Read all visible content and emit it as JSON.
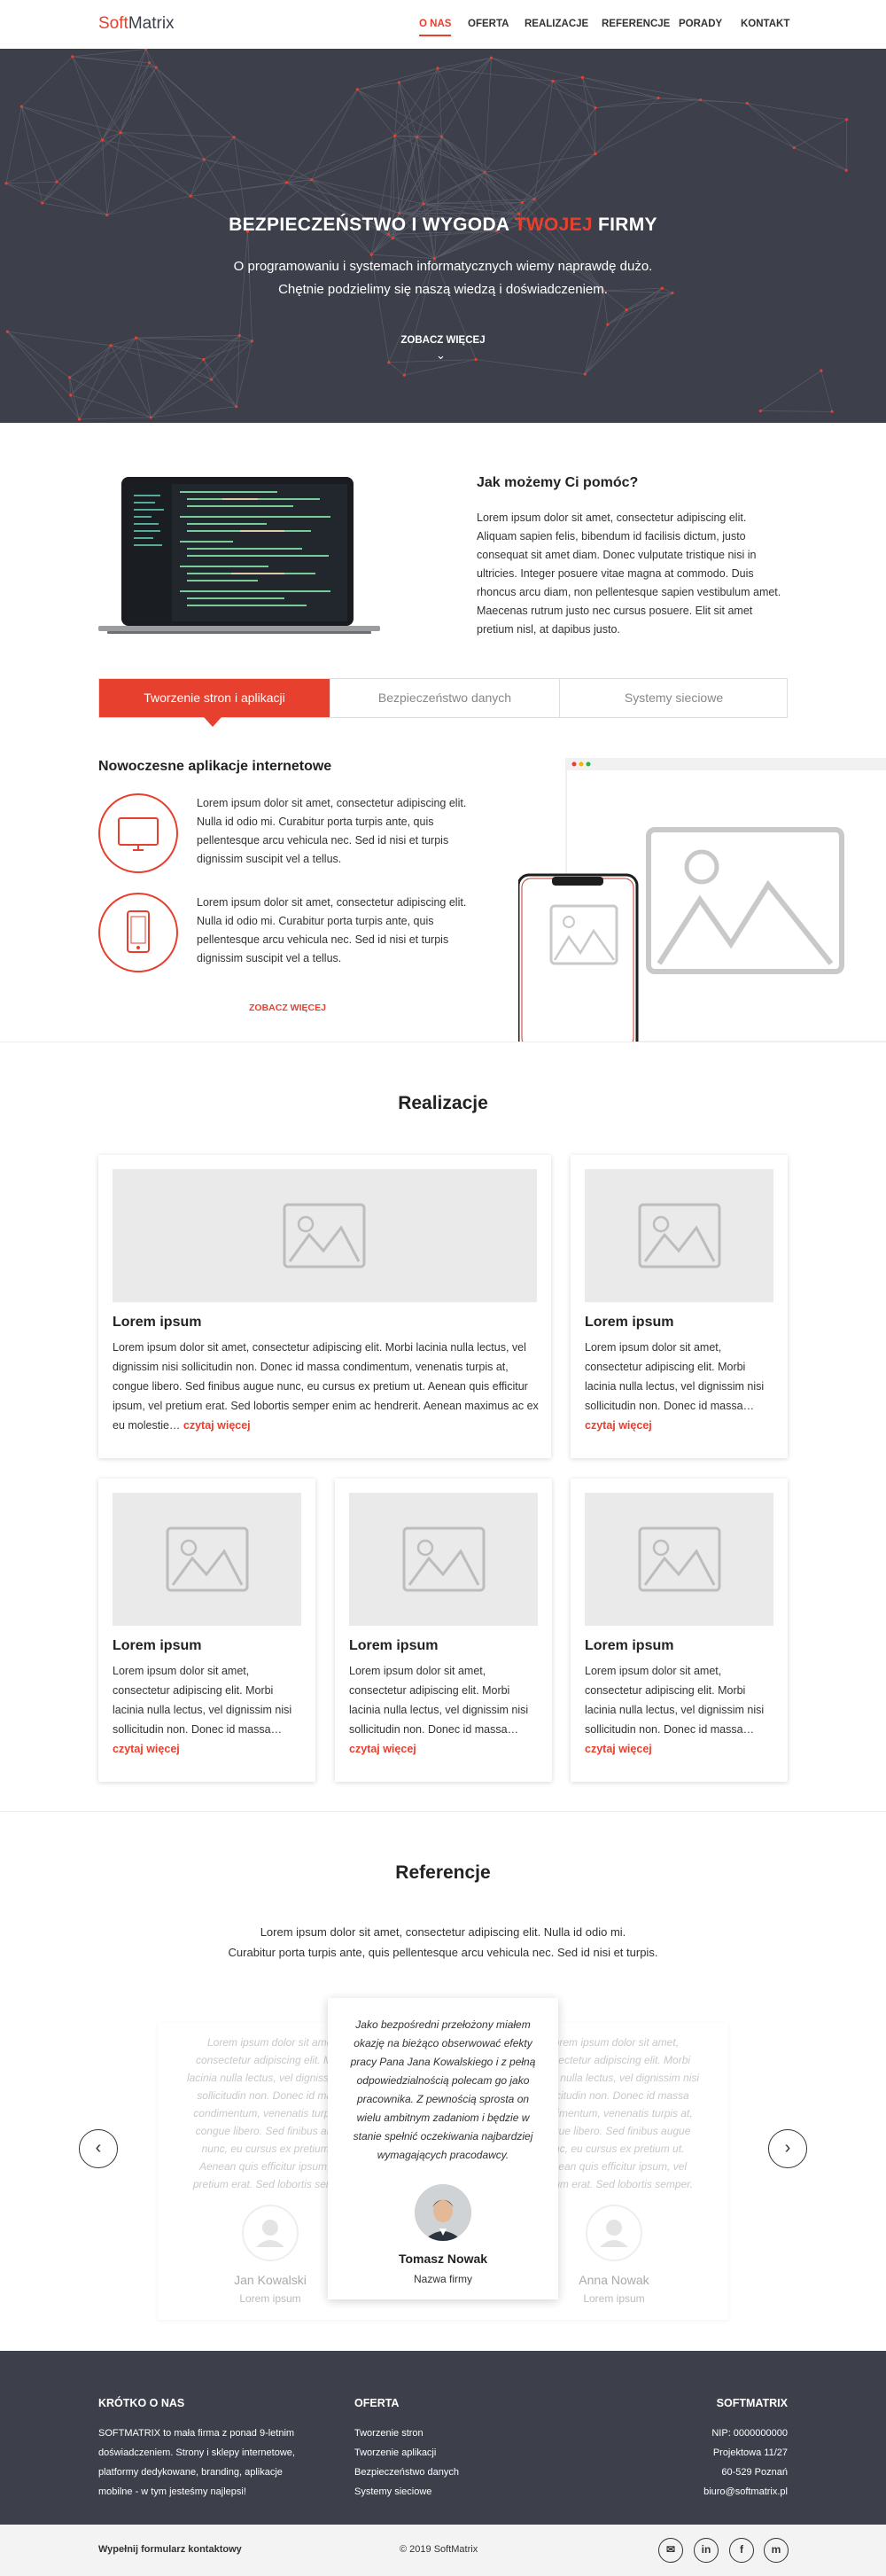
{
  "brand": {
    "soft": "Soft",
    "matrix": "Matrix"
  },
  "nav": [
    "O NAS",
    "OFERTA",
    "REALIZACJE",
    "REFERENCJE",
    "PORADY",
    "KONTAKT"
  ],
  "hero": {
    "title_a": "BEZPIECZEŃSTWO I WYGODA ",
    "title_b": "TWOJEJ",
    "title_c": " FIRMY",
    "sub1": "O programowaniu i systemach informatycznych wiemy naprawdę dużo.",
    "sub2": "Chętnie podzielimy się naszą wiedzą i doświadczeniem.",
    "more": "ZOBACZ WIĘCEJ"
  },
  "help": {
    "title": "Jak możemy Ci pomóc?",
    "text": "Lorem ipsum dolor sit amet, consectetur adipiscing elit. Aliquam sapien felis, bibendum id facilisis dictum, justo consequat sit amet diam. Donec vulputate tristique nisi in ultricies. Integer posuere vitae magna at commodo. Duis rhoncus arcu diam, non pellentesque sapien vestibulum amet. Maecenas rutrum justo nec cursus posuere. Elit sit amet pretium nisl, at dapibus justo."
  },
  "tabs": [
    "Tworzenie stron i aplikacji",
    "Bezpieczeństwo danych",
    "Systemy sieciowe"
  ],
  "apps": {
    "title": "Nowoczesne aplikacje internetowe",
    "item1": "Lorem ipsum dolor sit amet, consectetur adipiscing elit. Nulla id odio mi. Curabitur porta turpis ante, quis pellentesque arcu vehicula nec. Sed id nisi et turpis dignissim suscipit vel a tellus.",
    "item2": "Lorem ipsum dolor sit amet, consectetur adipiscing elit. Nulla id odio mi. Curabitur porta turpis ante, quis pellentesque arcu vehicula nec. Sed id nisi et turpis dignissim suscipit vel a tellus.",
    "more": "ZOBACZ WIĘCEJ"
  },
  "realizacje": {
    "title": "Realizacje",
    "big_title": "Lorem ipsum",
    "big_text": "Lorem ipsum dolor sit amet, consectetur adipiscing elit. Morbi lacinia nulla lectus, vel dignissim nisi sollicitudin non. Donec id massa condimentum, venenatis turpis at, congue libero. Sed finibus augue nunc, eu cursus ex pretium ut. Aenean quis efficitur ipsum, vel pretium erat. Sed lobortis semper enim ac hendrerit. Aenean maximus ac ex eu molestie… ",
    "small_title": "Lorem ipsum",
    "small_text": "Lorem ipsum dolor sit amet, consectetur adipiscing elit. Morbi lacinia nulla lectus, vel dignissim nisi sollicitudin non. Donec id massa… ",
    "more": "czytaj więcej"
  },
  "referencje": {
    "title": "Referencje",
    "intro1": "Lorem ipsum dolor sit amet, consectetur adipiscing elit. Nulla id odio mi.",
    "intro2": "Curabitur porta turpis ante, quis pellentesque arcu vehicula nec. Sed id nisi et turpis.",
    "faded_text": "Lorem ipsum dolor sit amet, consectetur adipiscing elit. Morbi lacinia nulla lectus, vel dignissim nisi sollicitudin non. Donec id massa condimentum, venenatis turpis at, congue libero. Sed finibus augue nunc, eu cursus ex pretium ut. Aenean quis efficitur ipsum, vel pretium erat. Sed lobortis semper.",
    "left_name": "Jan Kowalski",
    "left_role": "Lorem ipsum",
    "right_name": "Anna Nowak",
    "right_role": "Lorem ipsum",
    "quote": "Jako bezpośredni przełożony miałem okazję na bieżąco obserwować efekty pracy Pana Jana Kowalskiego i z pełną odpowiedzialnością polecam go jako pracownika. Z pewnością sprosta on wielu ambitnym zadaniom i będzie w stanie spełnić oczekiwania najbardziej wymagających pracodawcy.",
    "name": "Tomasz Nowak",
    "role": "Nazwa firmy"
  },
  "footer": {
    "about_title": "KRÓTKO O NAS",
    "about_text": "SOFTMATRIX to  mała firma z ponad 9-letnim doświadczeniem. Strony i sklepy internetowe, platformy dedykowane, branding, aplikacje mobilne - w tym jesteśmy najlepsi!",
    "offer_title": "OFERTA",
    "offer": [
      "Tworzenie stron",
      "Tworzenie aplikacji",
      "Bezpieczeństwo danych",
      "Systemy sieciowe"
    ],
    "company_title": "SOFTMATRIX",
    "company": [
      "NIP: 0000000000",
      "Projektowa 11/27",
      "60-529 Poznań",
      "biuro@softmatrix.pl"
    ],
    "form_link": "Wypełnij formularz kontaktowy",
    "copyright": "© 2019 SoftMatrix",
    "social": [
      "✉",
      "in",
      "f",
      "m"
    ]
  },
  "colors": {
    "accent": "#e8402f",
    "dark": "#3d3f4b"
  }
}
